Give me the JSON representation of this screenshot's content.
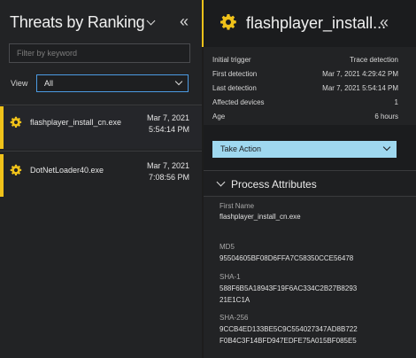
{
  "left": {
    "title": "Threats by Ranking",
    "collapse_glyph": "«",
    "filter_placeholder": "Filter by keyword",
    "view_label": "View",
    "view_value": "All",
    "threats": [
      {
        "name": "flashplayer_install_cn.exe",
        "date": "Mar 7, 2021",
        "time": "5:54:14 PM",
        "selected": true
      },
      {
        "name": "DotNetLoader40.exe",
        "date": "Mar 7, 2021",
        "time": "7:08:56 PM",
        "selected": false
      }
    ]
  },
  "right": {
    "title": "flashplayer_install...",
    "collapse_glyph": "«",
    "details": [
      {
        "key": "Initial trigger",
        "value": "Trace detection"
      },
      {
        "key": "First detection",
        "value": "Mar 7, 2021 4:29:42 PM"
      },
      {
        "key": "Last detection",
        "value": "Mar 7, 2021 5:54:14 PM"
      },
      {
        "key": "Affected devices",
        "value": "1"
      },
      {
        "key": "Age",
        "value": "6 hours"
      }
    ],
    "take_action_label": "Take Action",
    "process_attributes_title": "Process Attributes",
    "attributes": [
      {
        "key": "First Name",
        "value": "flashplayer_install_cn.exe"
      },
      {
        "key": "MD5",
        "value": "95504605BF08D6FFA7C58350CCE56478"
      },
      {
        "key": "SHA-1",
        "value": "588F6B5A18943F19F6AC334C2B27B8293\n21E1C1A"
      },
      {
        "key": "SHA-256",
        "value": "9CCB4ED133BE5C9C554027347AD8B722\nF0B4C3F14BFD947EDFE75A015BF085E5"
      }
    ]
  },
  "icons": {
    "threat_icon": "gear-icon",
    "accent_color": "#f0c21a",
    "take_action_color": "#9fd8ef"
  }
}
